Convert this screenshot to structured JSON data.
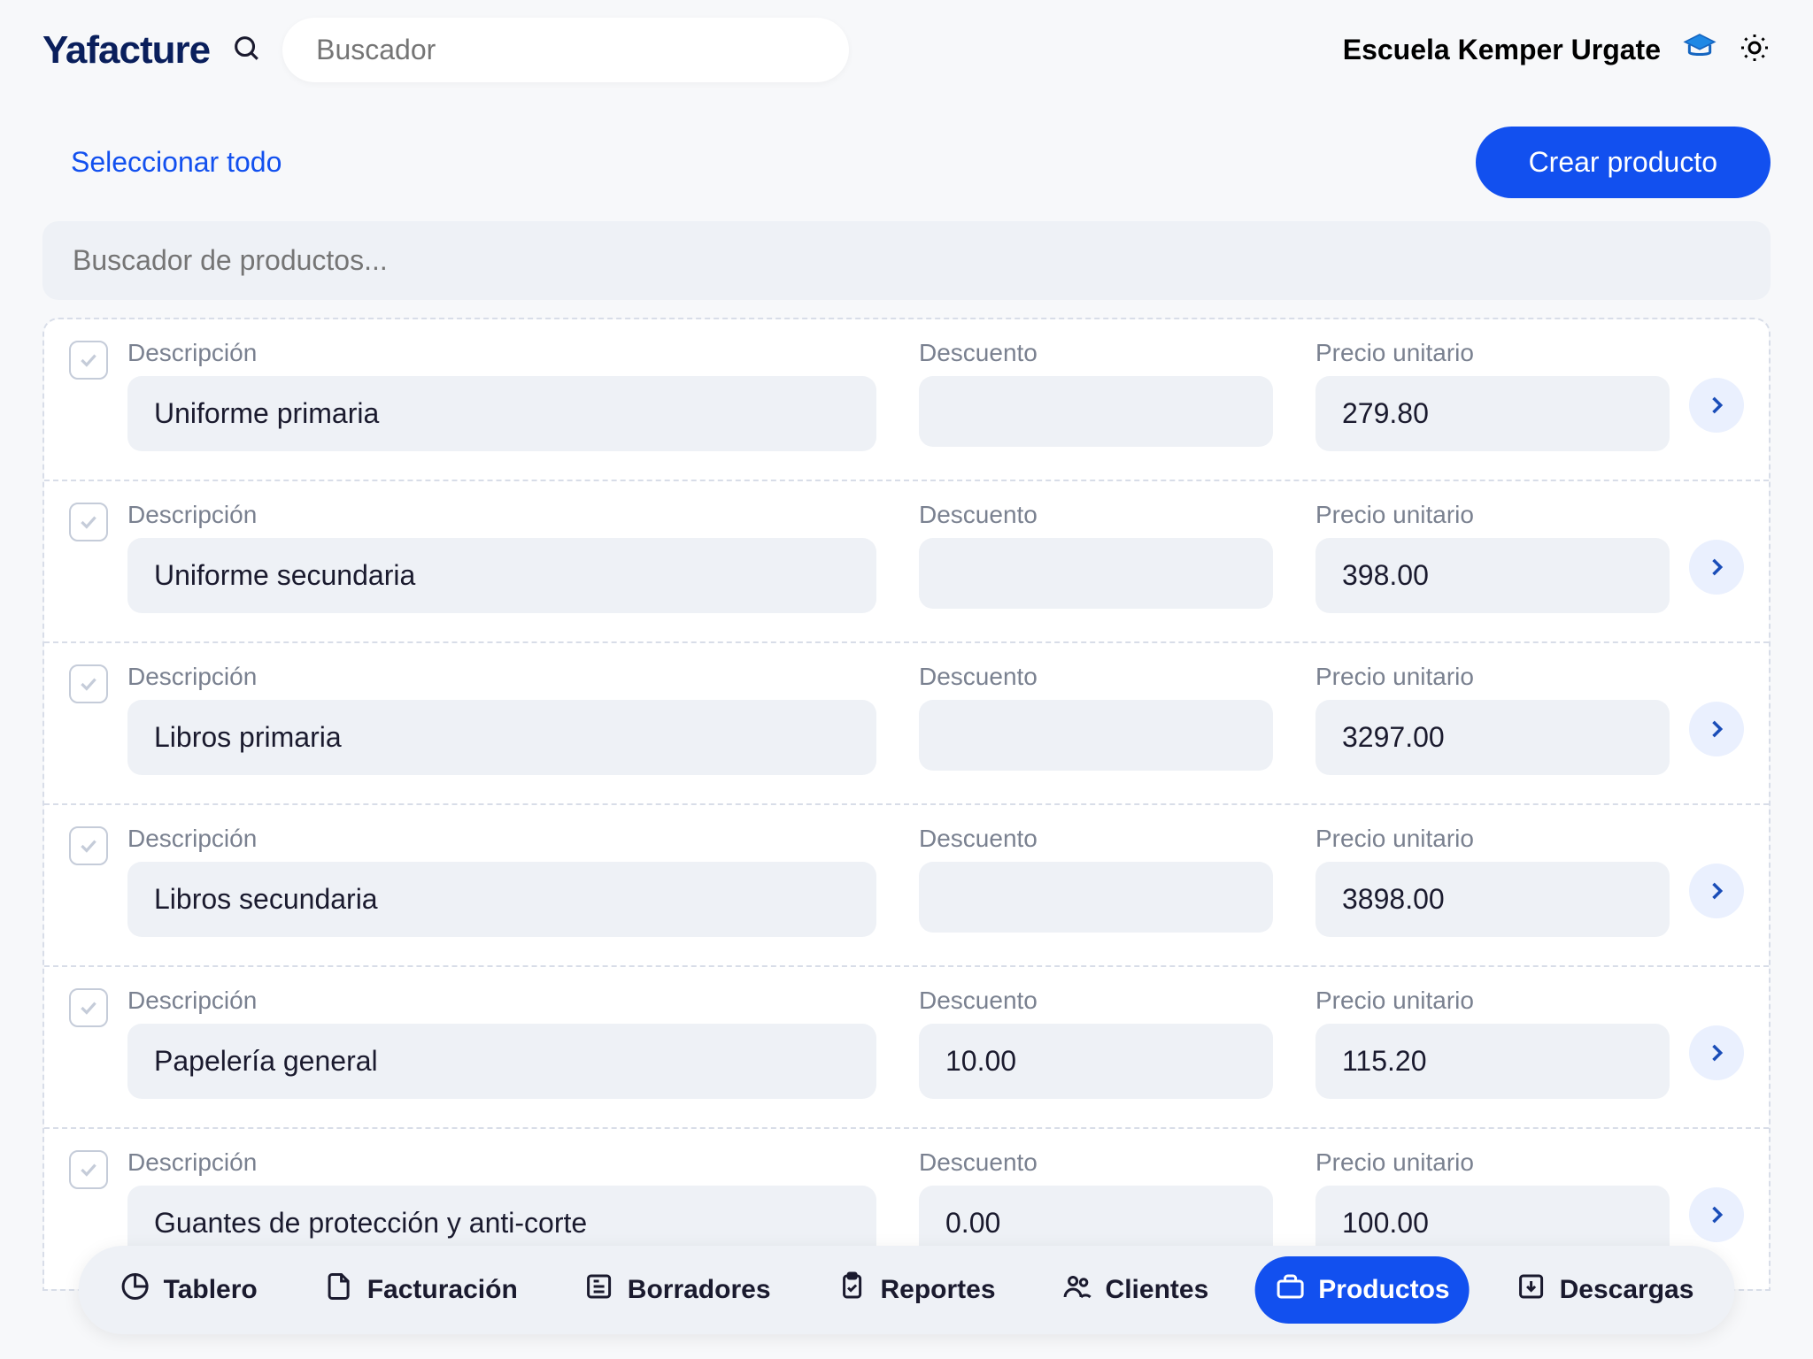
{
  "header": {
    "logo": "Yafacture",
    "search_placeholder": "Buscador",
    "org_name": "Escuela Kemper Urgate"
  },
  "toolbar": {
    "select_all": "Seleccionar todo",
    "create_btn": "Crear producto"
  },
  "product_search_placeholder": "Buscador de productos...",
  "labels": {
    "description": "Descripción",
    "discount": "Descuento",
    "unit_price": "Precio unitario"
  },
  "rows": [
    {
      "description": "Uniforme primaria",
      "discount": "",
      "price": "279.80"
    },
    {
      "description": "Uniforme secundaria",
      "discount": "",
      "price": "398.00"
    },
    {
      "description": "Libros primaria",
      "discount": "",
      "price": "3297.00"
    },
    {
      "description": "Libros secundaria",
      "discount": "",
      "price": "3898.00"
    },
    {
      "description": "Papelería general",
      "discount": "10.00",
      "price": "115.20"
    },
    {
      "description": "Guantes de protección y anti-corte",
      "discount": "0.00",
      "price": "100.00"
    }
  ],
  "nav": {
    "dashboard": "Tablero",
    "invoicing": "Facturación",
    "drafts": "Borradores",
    "reports": "Reportes",
    "clients": "Clientes",
    "products": "Productos",
    "downloads": "Descargas"
  }
}
